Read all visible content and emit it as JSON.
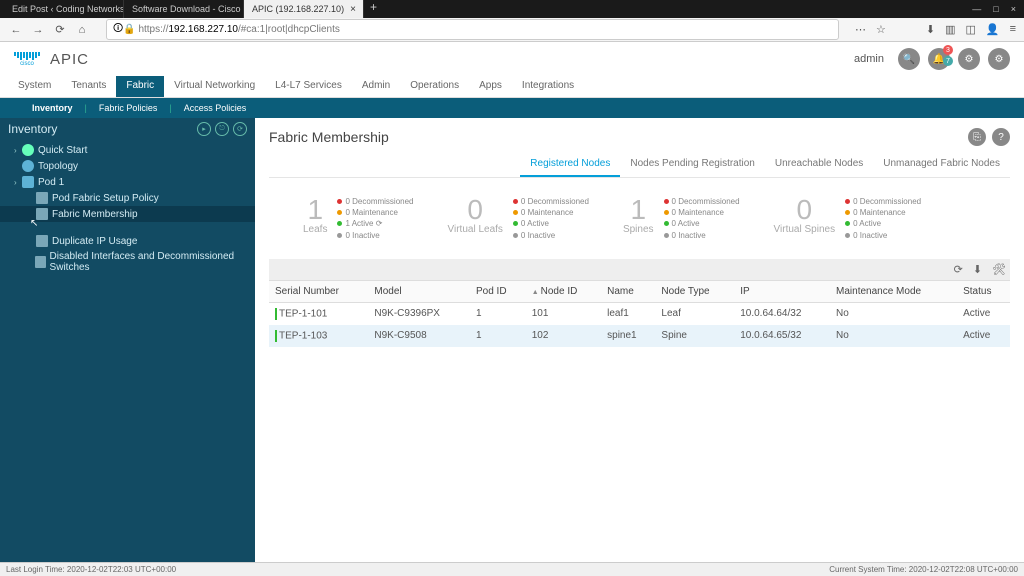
{
  "browser": {
    "tabs": [
      {
        "label": "Edit Post ‹ Coding Networks B"
      },
      {
        "label": "Software Download - Cisco Sy"
      },
      {
        "label": "APIC (192.168.227.10)"
      }
    ],
    "window_controls": {
      "min": "—",
      "max": "□",
      "close": "×"
    },
    "nav": {
      "back": "←",
      "fwd": "→",
      "reload": "⟳",
      "home": "⌂"
    },
    "lock": "🔒",
    "url_prefix": "https://",
    "url_host": "192.168.227.10",
    "url_path": "/#ca:1|root|dhcpClients",
    "right_icons": {
      "dots": "⋯",
      "star": "☆",
      "download": "⬇",
      "library": "▥",
      "screenshot": "◫",
      "account": "👤",
      "menu": "≡"
    }
  },
  "header": {
    "logo_text": "cisco",
    "app_name": "APIC",
    "user": "admin",
    "icons": {
      "search": "🔍",
      "bell": "🔔",
      "wheel": "⚙",
      "gear": "⚙"
    },
    "badges": {
      "red": "3",
      "blue": "7"
    }
  },
  "main_nav": [
    "System",
    "Tenants",
    "Fabric",
    "Virtual Networking",
    "L4-L7 Services",
    "Admin",
    "Operations",
    "Apps",
    "Integrations"
  ],
  "main_nav_active": "Fabric",
  "sub_nav": [
    "Inventory",
    "Fabric Policies",
    "Access Policies"
  ],
  "sub_nav_active": "Inventory",
  "sidebar": {
    "title": "Inventory",
    "items": [
      {
        "label": "Quick Start",
        "indent": false,
        "icon": "circle",
        "selected": false,
        "caret": "›"
      },
      {
        "label": "Topology",
        "indent": false,
        "icon": "globe",
        "selected": false,
        "caret": ""
      },
      {
        "label": "Pod 1",
        "indent": false,
        "icon": "box",
        "selected": false,
        "caret": "›"
      },
      {
        "label": "Pod Fabric Setup Policy",
        "indent": true,
        "icon": "folder",
        "selected": false,
        "caret": ""
      },
      {
        "label": "Fabric Membership",
        "indent": true,
        "icon": "folder",
        "selected": true,
        "caret": ""
      },
      {
        "label": "Duplicate IP Usage",
        "indent": true,
        "icon": "folder",
        "selected": false,
        "caret": ""
      },
      {
        "label": "Disabled Interfaces and Decommissioned Switches",
        "indent": true,
        "icon": "folder",
        "selected": false,
        "caret": ""
      }
    ]
  },
  "page": {
    "title": "Fabric Membership",
    "tabs": [
      "Registered Nodes",
      "Nodes Pending Registration",
      "Unreachable Nodes",
      "Unmanaged Fabric Nodes"
    ],
    "tabs_active": "Registered Nodes",
    "stats": [
      {
        "num": "1",
        "label": "Leafs",
        "legend": [
          [
            "red",
            "0 Decommissioned"
          ],
          [
            "orange",
            "0 Maintenance"
          ],
          [
            "green",
            "1 Active ⟳"
          ],
          [
            "gray",
            "0 Inactive"
          ]
        ]
      },
      {
        "num": "0",
        "label": "Virtual Leafs",
        "legend": [
          [
            "red",
            "0 Decommissioned"
          ],
          [
            "orange",
            "0 Maintenance"
          ],
          [
            "green",
            "0 Active"
          ],
          [
            "gray",
            "0 Inactive"
          ]
        ]
      },
      {
        "num": "1",
        "label": "Spines",
        "legend": [
          [
            "red",
            "0 Decommissioned"
          ],
          [
            "orange",
            "0 Maintenance"
          ],
          [
            "green",
            "0 Active"
          ],
          [
            "gray",
            "0 Inactive"
          ]
        ]
      },
      {
        "num": "0",
        "label": "Virtual Spines",
        "legend": [
          [
            "red",
            "0 Decommissioned"
          ],
          [
            "orange",
            "0 Maintenance"
          ],
          [
            "green",
            "0 Active"
          ],
          [
            "gray",
            "0 Inactive"
          ]
        ]
      }
    ],
    "table": {
      "cols": [
        "Serial Number",
        "Model",
        "Pod ID",
        "Node ID",
        "Name",
        "Node Type",
        "IP",
        "Maintenance Mode",
        "Status"
      ],
      "sort_col": "Node ID",
      "rows": [
        {
          "serial": "TEP-1-101",
          "model": "N9K-C9396PX",
          "pod": "1",
          "node": "101",
          "name": "leaf1",
          "type": "Leaf",
          "ip": "10.0.64.64/32",
          "maint": "No",
          "status": "Active"
        },
        {
          "serial": "TEP-1-103",
          "model": "N9K-C9508",
          "pod": "1",
          "node": "102",
          "name": "spine1",
          "type": "Spine",
          "ip": "10.0.64.65/32",
          "maint": "No",
          "status": "Active"
        }
      ],
      "toolbar": {
        "refresh": "⟳",
        "download": "⬇",
        "tools": "🛠"
      }
    }
  },
  "status": {
    "left": "Last Login Time: 2020-12-02T22:03 UTC+00:00",
    "right": "Current System Time: 2020-12-02T22:08 UTC+00:00"
  }
}
